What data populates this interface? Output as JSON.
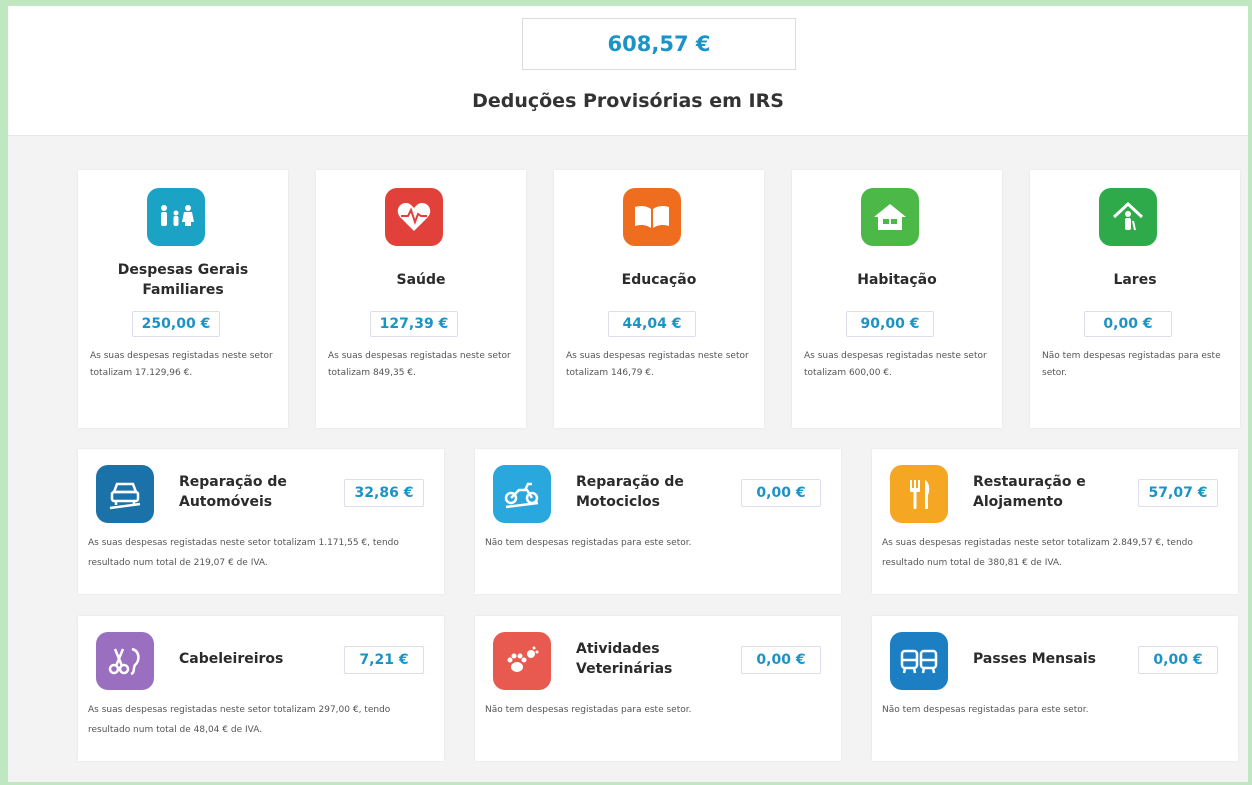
{
  "header": {
    "total": "608,57 €",
    "title": "Deduções Provisórias em IRS"
  },
  "categories_top": [
    {
      "name": "Despesas Gerais Familiares",
      "amount": "250,00 €",
      "desc": "As suas despesas registadas neste setor totalizam 17.129,96 €.",
      "icon": "family-icon",
      "color": "#1ba3c6"
    },
    {
      "name": "Saúde",
      "amount": "127,39 €",
      "desc": "As suas despesas registadas neste setor totalizam 849,35 €.",
      "icon": "heart-icon",
      "color": "#e2403a"
    },
    {
      "name": "Educação",
      "amount": "44,04 €",
      "desc": "As suas despesas registadas neste setor totalizam 146,79 €.",
      "icon": "book-icon",
      "color": "#ef6d1f"
    },
    {
      "name": "Habitação",
      "amount": "90,00 €",
      "desc": "As suas despesas registadas neste setor totalizam 600,00 €.",
      "icon": "house-icon",
      "color": "#4cb848"
    },
    {
      "name": "Lares",
      "amount": "0,00 €",
      "desc": "Não tem despesas registadas para este setor.",
      "icon": "elderly-home-icon",
      "color": "#2faa4a"
    }
  ],
  "categories_mid": [
    {
      "name": "Reparação de Automóveis",
      "amount": "32,86 €",
      "desc": "As suas despesas registadas neste setor totalizam 1.171,55 €, tendo resultado num total de 219,07 € de IVA.",
      "icon": "car-icon",
      "color": "#1b72a8"
    },
    {
      "name": "Reparação de Motociclos",
      "amount": "0,00 €",
      "desc": "Não tem despesas registadas para este setor.",
      "icon": "motorcycle-icon",
      "color": "#2aa7dc"
    },
    {
      "name": "Restauração e Alojamento",
      "amount": "57,07 €",
      "desc": "As suas despesas registadas neste setor totalizam 2.849,57 €, tendo resultado num total de 380,81 € de IVA.",
      "icon": "cutlery-icon",
      "color": "#f5a623"
    }
  ],
  "categories_bottom": [
    {
      "name": "Cabeleireiros",
      "amount": "7,21 €",
      "desc": "As suas despesas registadas neste setor totalizam 297,00 €, tendo resultado num total de 48,04 € de IVA.",
      "icon": "scissors-icon",
      "color": "#9b6fc0"
    },
    {
      "name": "Atividades Veterinárias",
      "amount": "0,00 €",
      "desc": "Não tem despesas registadas para este setor.",
      "icon": "paw-icon",
      "color": "#e85a4f"
    },
    {
      "name": "Passes Mensais",
      "amount": "0,00 €",
      "desc": "Não tem despesas registadas para este setor.",
      "icon": "bus-icon",
      "color": "#1c7fc4"
    }
  ]
}
